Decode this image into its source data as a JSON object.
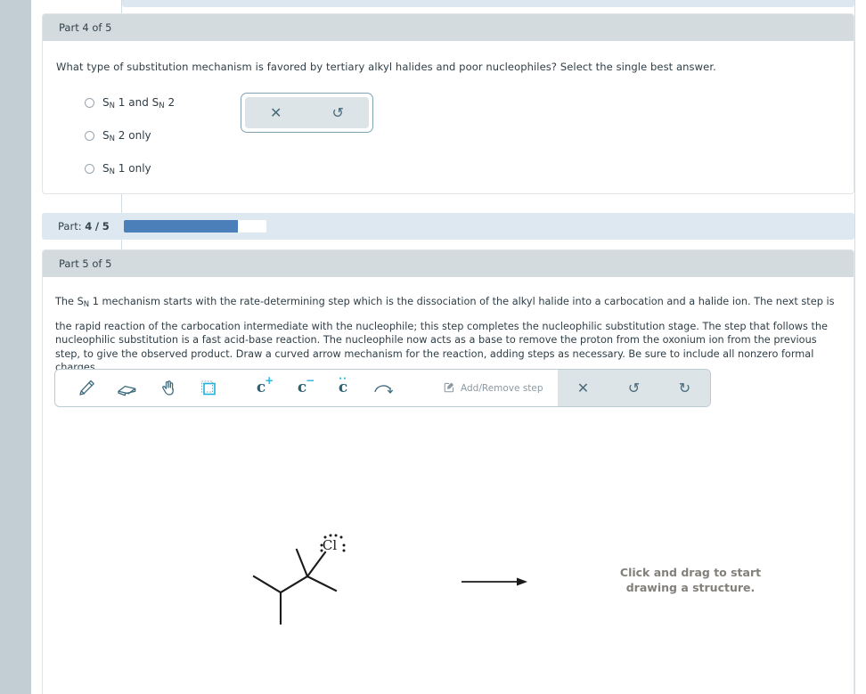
{
  "part4": {
    "header": "Part 4 of 5",
    "question": "What type of substitution mechanism is favored by tertiary alkyl halides and poor nucleophiles? Select the single best answer.",
    "options": [
      {
        "prefix": "S",
        "sub": "N",
        "rest": "1 and S",
        "sub2": "N",
        "rest2": "2"
      },
      {
        "prefix": "S",
        "sub": "N",
        "rest": "2 only"
      },
      {
        "prefix": "S",
        "sub": "N",
        "rest": "1 only"
      }
    ],
    "mini_pill": {
      "close_label": "✕",
      "reset_label": "↺"
    }
  },
  "progress": {
    "label_prefix": "Part:",
    "current": "4",
    "separator": "/",
    "total": "5",
    "percent": 80,
    "fill_color": "#4a7fba"
  },
  "part5": {
    "header": "Part 5 of 5",
    "paragraph_1_a": "The S",
    "paragraph_1_sub": "N",
    "paragraph_1_b": "1 mechanism starts with the rate-determining step which is the dissociation of the alkyl halide into a carbocation and a halide ion. The next step is",
    "paragraph_2": "the rapid reaction of the carbocation intermediate with the nucleophile; this step completes the nucleophilic substitution stage. The step that follows the nucleophilic substitution is a fast acid-base reaction. The nucleophile now acts as a base to remove the proton from the oxonium ion from the previous step, to give the observed product. Draw a curved arrow mechanism for the reaction, adding steps as necessary. Be sure to include all nonzero formal charges."
  },
  "toolbar": {
    "tools": [
      {
        "name": "pencil-tool",
        "label": "Draw"
      },
      {
        "name": "eraser-tool",
        "label": "Erase"
      },
      {
        "name": "hand-tool",
        "label": "Pan"
      },
      {
        "name": "select-tool",
        "label": "Select",
        "active": true
      },
      {
        "name": "carbon-plus-tool",
        "label": "C+",
        "glyph": "c",
        "sup": "+"
      },
      {
        "name": "carbon-minus-tool",
        "label": "C-",
        "glyph": "c",
        "sup": "−"
      },
      {
        "name": "carbon-radical-tool",
        "label": "C radical",
        "glyph": "c",
        "dots": "··"
      },
      {
        "name": "curved-arrow-tool",
        "label": "Curved arrow"
      }
    ],
    "add_remove_step": "Add/Remove step",
    "clear_label": "✕",
    "undo_label": "↺",
    "redo_label": "↻",
    "accent_color": "#1bb3dd",
    "icon_color": "#3d6b7d"
  },
  "canvas": {
    "molecule_label": "Cl",
    "hint_line_1": "Click and drag to start",
    "hint_line_2": "drawing a structure."
  }
}
